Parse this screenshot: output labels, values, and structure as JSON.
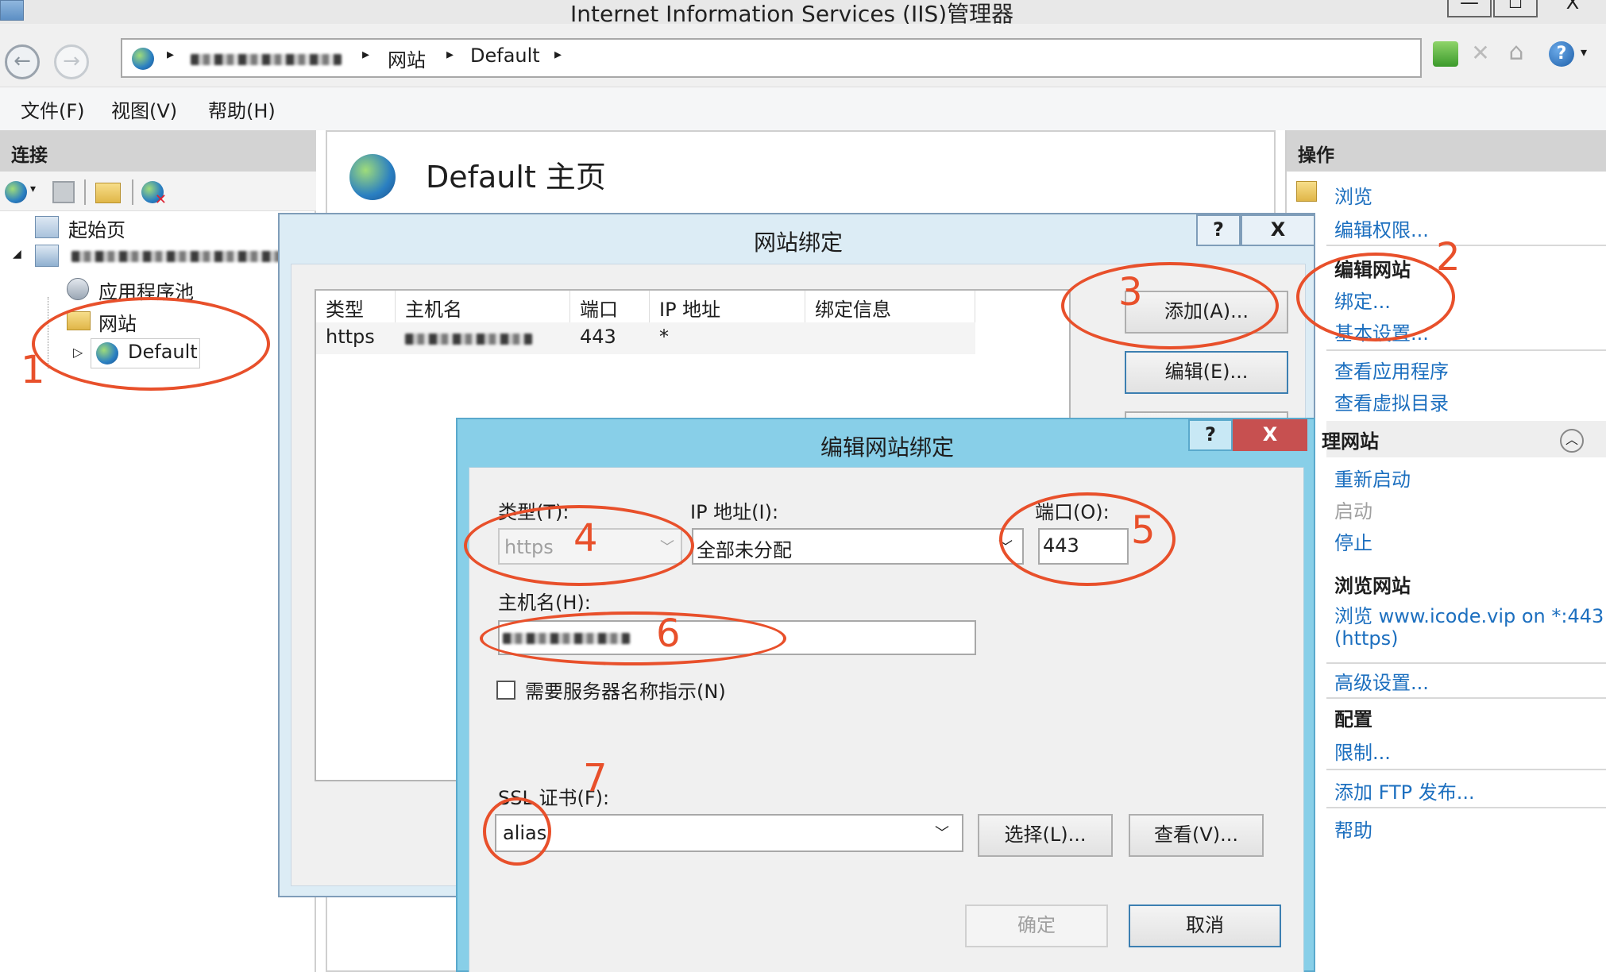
{
  "window": {
    "title": "Internet Information Services (IIS)管理器",
    "controls": [
      "—",
      "☐",
      "X"
    ]
  },
  "address": {
    "crumbs": [
      "网站",
      "Default"
    ]
  },
  "menu": [
    "文件(F)",
    "视图(V)",
    "帮助(H)"
  ],
  "connections": {
    "header": "连接",
    "tree": {
      "start_page": "起始页",
      "app_pools": "应用程序池",
      "sites": "网站",
      "default": "Default"
    }
  },
  "main": {
    "title": "Default 主页"
  },
  "actions": {
    "header": "操作",
    "browse": "浏览",
    "edit_permissions": "编辑权限...",
    "edit_site_header": "编辑网站",
    "bindings": "绑定...",
    "basic_settings": "基本设置...",
    "view_apps": "查看应用程序",
    "view_vdirs": "查看虚拟目录",
    "manage_site_header": "理网站",
    "restart": "重新启动",
    "start": "启动",
    "stop": "停止",
    "browse_site_header": "浏览网站",
    "browse_link_1": "浏览 www.icode.vip on *:443",
    "browse_link_2": "(https)",
    "advanced": "高级设置...",
    "config_header": "配置",
    "limits": "限制...",
    "add_ftp": "添加 FTP 发布...",
    "help": "帮助"
  },
  "bindings_dialog": {
    "title": "网站绑定",
    "help_btn": "?",
    "close_btn": "X",
    "columns": [
      "类型",
      "主机名",
      "端口",
      "IP 地址",
      "绑定信息"
    ],
    "rows": [
      {
        "type": "https",
        "port": "443",
        "ip": "*"
      }
    ],
    "add_btn": "添加(A)...",
    "edit_btn": "编辑(E)..."
  },
  "edit_dialog": {
    "title": "编辑网站绑定",
    "help_btn": "?",
    "close_btn": "X",
    "type_label": "类型(T):",
    "type_value": "https",
    "ip_label": "IP 地址(I):",
    "ip_value": "全部未分配",
    "port_label": "端口(O):",
    "port_value": "443",
    "host_label": "主机名(H):",
    "sni_label": "需要服务器名称指示(N)",
    "ssl_label": "SSL 证书(F):",
    "ssl_value": "alias",
    "select_btn": "选择(L)...",
    "view_btn": "查看(V)...",
    "ok_btn": "确定",
    "cancel_btn": "取消"
  },
  "annotations": [
    "1",
    "2",
    "3",
    "4",
    "5",
    "6",
    "7"
  ],
  "colors": {
    "annotation": "#e8502b",
    "link": "#1c6fbf",
    "dialog_title_bg": "#88cfe8",
    "close_red": "#c75050"
  }
}
